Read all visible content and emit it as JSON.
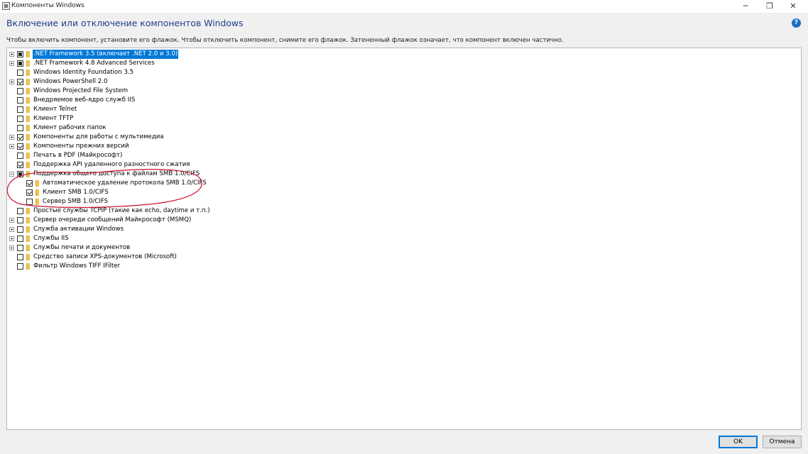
{
  "window": {
    "title": "Компоненты Windows",
    "controls": {
      "minimize": "─",
      "restore": "❐",
      "close": "✕"
    }
  },
  "heading": "Включение или отключение компонентов Windows",
  "description": "Чтобы включить компонент, установите его флажок. Чтобы отключить компонент, снимите его флажок. Затененный флажок означает, что компонент включен частично.",
  "help": "?",
  "features": [
    {
      "label": ".NET Framework 3.5 (включает .NET 2.0 и 3.0)",
      "state": "partial",
      "expander": "plus",
      "level": 0,
      "selected": true
    },
    {
      "label": ".NET Framework 4.8 Advanced Services",
      "state": "partial",
      "expander": "plus",
      "level": 0
    },
    {
      "label": "Windows Identity Foundation 3.5",
      "state": "unchecked",
      "expander": "none",
      "level": 0
    },
    {
      "label": "Windows PowerShell 2.0",
      "state": "checked",
      "expander": "plus",
      "level": 0
    },
    {
      "label": "Windows Projected File System",
      "state": "unchecked",
      "expander": "none",
      "level": 0
    },
    {
      "label": "Внедряемое веб-ядро служб IIS",
      "state": "unchecked",
      "expander": "none",
      "level": 0
    },
    {
      "label": "Клиент Telnet",
      "state": "unchecked",
      "expander": "none",
      "level": 0
    },
    {
      "label": "Клиент TFTP",
      "state": "unchecked",
      "expander": "none",
      "level": 0
    },
    {
      "label": "Клиент рабочих папок",
      "state": "unchecked",
      "expander": "none",
      "level": 0
    },
    {
      "label": "Компоненты для работы с мультимедиа",
      "state": "checked",
      "expander": "plus",
      "level": 0
    },
    {
      "label": "Компоненты прежних версий",
      "state": "checked",
      "expander": "plus",
      "level": 0
    },
    {
      "label": "Печать в PDF (Майкрософт)",
      "state": "unchecked",
      "expander": "none",
      "level": 0
    },
    {
      "label": "Поддержка API удаленного разностного сжатия",
      "state": "checked",
      "expander": "none",
      "level": 0
    },
    {
      "label": "Поддержка общего доступа к файлам SMB 1.0/CIFS",
      "state": "partial",
      "expander": "minus",
      "level": 0
    },
    {
      "label": "Автоматическое удаление протокола SMB 1.0/CIFS",
      "state": "checked",
      "expander": "none",
      "level": 1
    },
    {
      "label": "Клиент SMB 1.0/CIFS",
      "state": "checked",
      "expander": "none",
      "level": 1
    },
    {
      "label": "Сервер SMB 1.0/CIFS",
      "state": "unchecked",
      "expander": "none",
      "level": 1
    },
    {
      "label": "Простые службы TCPIP (такие как echo, daytime и т.п.)",
      "state": "unchecked",
      "expander": "none",
      "level": 0
    },
    {
      "label": "Сервер очереди сообщений Майкрософт (MSMQ)",
      "state": "unchecked",
      "expander": "plus",
      "level": 0
    },
    {
      "label": "Служба активации Windows",
      "state": "unchecked",
      "expander": "plus",
      "level": 0
    },
    {
      "label": "Службы IIS",
      "state": "unchecked",
      "expander": "plus",
      "level": 0
    },
    {
      "label": "Службы печати и документов",
      "state": "unchecked",
      "expander": "plus",
      "level": 0
    },
    {
      "label": "Средство записи XPS-документов (Microsoft)",
      "state": "unchecked",
      "expander": "none",
      "level": 0
    },
    {
      "label": "Фильтр Windows TIFF IFilter",
      "state": "unchecked",
      "expander": "none",
      "level": 0
    }
  ],
  "buttons": {
    "ok": "OK",
    "cancel": "Отмена"
  },
  "colors": {
    "heading": "#1e3f8a",
    "selection": "#0078d7",
    "annotation": "#c8102e",
    "folder": "#f1c34c"
  }
}
